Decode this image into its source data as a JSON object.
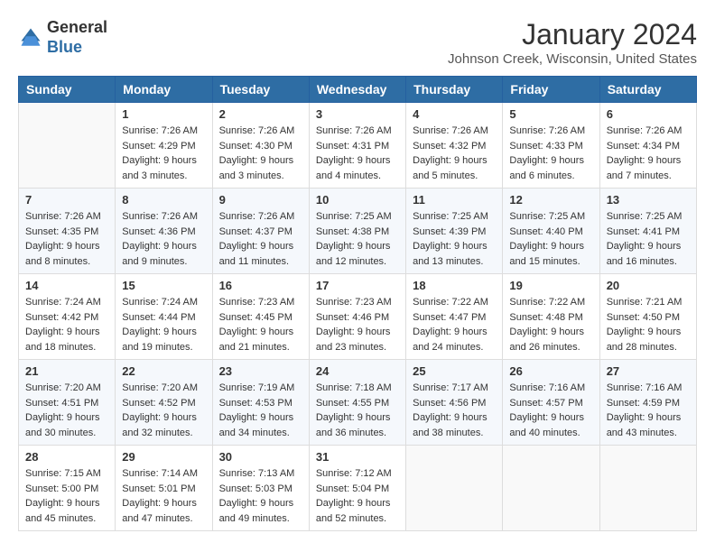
{
  "header": {
    "logo_general": "General",
    "logo_blue": "Blue",
    "month_year": "January 2024",
    "location": "Johnson Creek, Wisconsin, United States"
  },
  "days_of_week": [
    "Sunday",
    "Monday",
    "Tuesday",
    "Wednesday",
    "Thursday",
    "Friday",
    "Saturday"
  ],
  "weeks": [
    [
      {
        "day": "",
        "sunrise": "",
        "sunset": "",
        "daylight": ""
      },
      {
        "day": "1",
        "sunrise": "Sunrise: 7:26 AM",
        "sunset": "Sunset: 4:29 PM",
        "daylight": "Daylight: 9 hours and 3 minutes."
      },
      {
        "day": "2",
        "sunrise": "Sunrise: 7:26 AM",
        "sunset": "Sunset: 4:30 PM",
        "daylight": "Daylight: 9 hours and 3 minutes."
      },
      {
        "day": "3",
        "sunrise": "Sunrise: 7:26 AM",
        "sunset": "Sunset: 4:31 PM",
        "daylight": "Daylight: 9 hours and 4 minutes."
      },
      {
        "day": "4",
        "sunrise": "Sunrise: 7:26 AM",
        "sunset": "Sunset: 4:32 PM",
        "daylight": "Daylight: 9 hours and 5 minutes."
      },
      {
        "day": "5",
        "sunrise": "Sunrise: 7:26 AM",
        "sunset": "Sunset: 4:33 PM",
        "daylight": "Daylight: 9 hours and 6 minutes."
      },
      {
        "day": "6",
        "sunrise": "Sunrise: 7:26 AM",
        "sunset": "Sunset: 4:34 PM",
        "daylight": "Daylight: 9 hours and 7 minutes."
      }
    ],
    [
      {
        "day": "7",
        "sunrise": "Sunrise: 7:26 AM",
        "sunset": "Sunset: 4:35 PM",
        "daylight": "Daylight: 9 hours and 8 minutes."
      },
      {
        "day": "8",
        "sunrise": "Sunrise: 7:26 AM",
        "sunset": "Sunset: 4:36 PM",
        "daylight": "Daylight: 9 hours and 9 minutes."
      },
      {
        "day": "9",
        "sunrise": "Sunrise: 7:26 AM",
        "sunset": "Sunset: 4:37 PM",
        "daylight": "Daylight: 9 hours and 11 minutes."
      },
      {
        "day": "10",
        "sunrise": "Sunrise: 7:25 AM",
        "sunset": "Sunset: 4:38 PM",
        "daylight": "Daylight: 9 hours and 12 minutes."
      },
      {
        "day": "11",
        "sunrise": "Sunrise: 7:25 AM",
        "sunset": "Sunset: 4:39 PM",
        "daylight": "Daylight: 9 hours and 13 minutes."
      },
      {
        "day": "12",
        "sunrise": "Sunrise: 7:25 AM",
        "sunset": "Sunset: 4:40 PM",
        "daylight": "Daylight: 9 hours and 15 minutes."
      },
      {
        "day": "13",
        "sunrise": "Sunrise: 7:25 AM",
        "sunset": "Sunset: 4:41 PM",
        "daylight": "Daylight: 9 hours and 16 minutes."
      }
    ],
    [
      {
        "day": "14",
        "sunrise": "Sunrise: 7:24 AM",
        "sunset": "Sunset: 4:42 PM",
        "daylight": "Daylight: 9 hours and 18 minutes."
      },
      {
        "day": "15",
        "sunrise": "Sunrise: 7:24 AM",
        "sunset": "Sunset: 4:44 PM",
        "daylight": "Daylight: 9 hours and 19 minutes."
      },
      {
        "day": "16",
        "sunrise": "Sunrise: 7:23 AM",
        "sunset": "Sunset: 4:45 PM",
        "daylight": "Daylight: 9 hours and 21 minutes."
      },
      {
        "day": "17",
        "sunrise": "Sunrise: 7:23 AM",
        "sunset": "Sunset: 4:46 PM",
        "daylight": "Daylight: 9 hours and 23 minutes."
      },
      {
        "day": "18",
        "sunrise": "Sunrise: 7:22 AM",
        "sunset": "Sunset: 4:47 PM",
        "daylight": "Daylight: 9 hours and 24 minutes."
      },
      {
        "day": "19",
        "sunrise": "Sunrise: 7:22 AM",
        "sunset": "Sunset: 4:48 PM",
        "daylight": "Daylight: 9 hours and 26 minutes."
      },
      {
        "day": "20",
        "sunrise": "Sunrise: 7:21 AM",
        "sunset": "Sunset: 4:50 PM",
        "daylight": "Daylight: 9 hours and 28 minutes."
      }
    ],
    [
      {
        "day": "21",
        "sunrise": "Sunrise: 7:20 AM",
        "sunset": "Sunset: 4:51 PM",
        "daylight": "Daylight: 9 hours and 30 minutes."
      },
      {
        "day": "22",
        "sunrise": "Sunrise: 7:20 AM",
        "sunset": "Sunset: 4:52 PM",
        "daylight": "Daylight: 9 hours and 32 minutes."
      },
      {
        "day": "23",
        "sunrise": "Sunrise: 7:19 AM",
        "sunset": "Sunset: 4:53 PM",
        "daylight": "Daylight: 9 hours and 34 minutes."
      },
      {
        "day": "24",
        "sunrise": "Sunrise: 7:18 AM",
        "sunset": "Sunset: 4:55 PM",
        "daylight": "Daylight: 9 hours and 36 minutes."
      },
      {
        "day": "25",
        "sunrise": "Sunrise: 7:17 AM",
        "sunset": "Sunset: 4:56 PM",
        "daylight": "Daylight: 9 hours and 38 minutes."
      },
      {
        "day": "26",
        "sunrise": "Sunrise: 7:16 AM",
        "sunset": "Sunset: 4:57 PM",
        "daylight": "Daylight: 9 hours and 40 minutes."
      },
      {
        "day": "27",
        "sunrise": "Sunrise: 7:16 AM",
        "sunset": "Sunset: 4:59 PM",
        "daylight": "Daylight: 9 hours and 43 minutes."
      }
    ],
    [
      {
        "day": "28",
        "sunrise": "Sunrise: 7:15 AM",
        "sunset": "Sunset: 5:00 PM",
        "daylight": "Daylight: 9 hours and 45 minutes."
      },
      {
        "day": "29",
        "sunrise": "Sunrise: 7:14 AM",
        "sunset": "Sunset: 5:01 PM",
        "daylight": "Daylight: 9 hours and 47 minutes."
      },
      {
        "day": "30",
        "sunrise": "Sunrise: 7:13 AM",
        "sunset": "Sunset: 5:03 PM",
        "daylight": "Daylight: 9 hours and 49 minutes."
      },
      {
        "day": "31",
        "sunrise": "Sunrise: 7:12 AM",
        "sunset": "Sunset: 5:04 PM",
        "daylight": "Daylight: 9 hours and 52 minutes."
      },
      {
        "day": "",
        "sunrise": "",
        "sunset": "",
        "daylight": ""
      },
      {
        "day": "",
        "sunrise": "",
        "sunset": "",
        "daylight": ""
      },
      {
        "day": "",
        "sunrise": "",
        "sunset": "",
        "daylight": ""
      }
    ]
  ]
}
